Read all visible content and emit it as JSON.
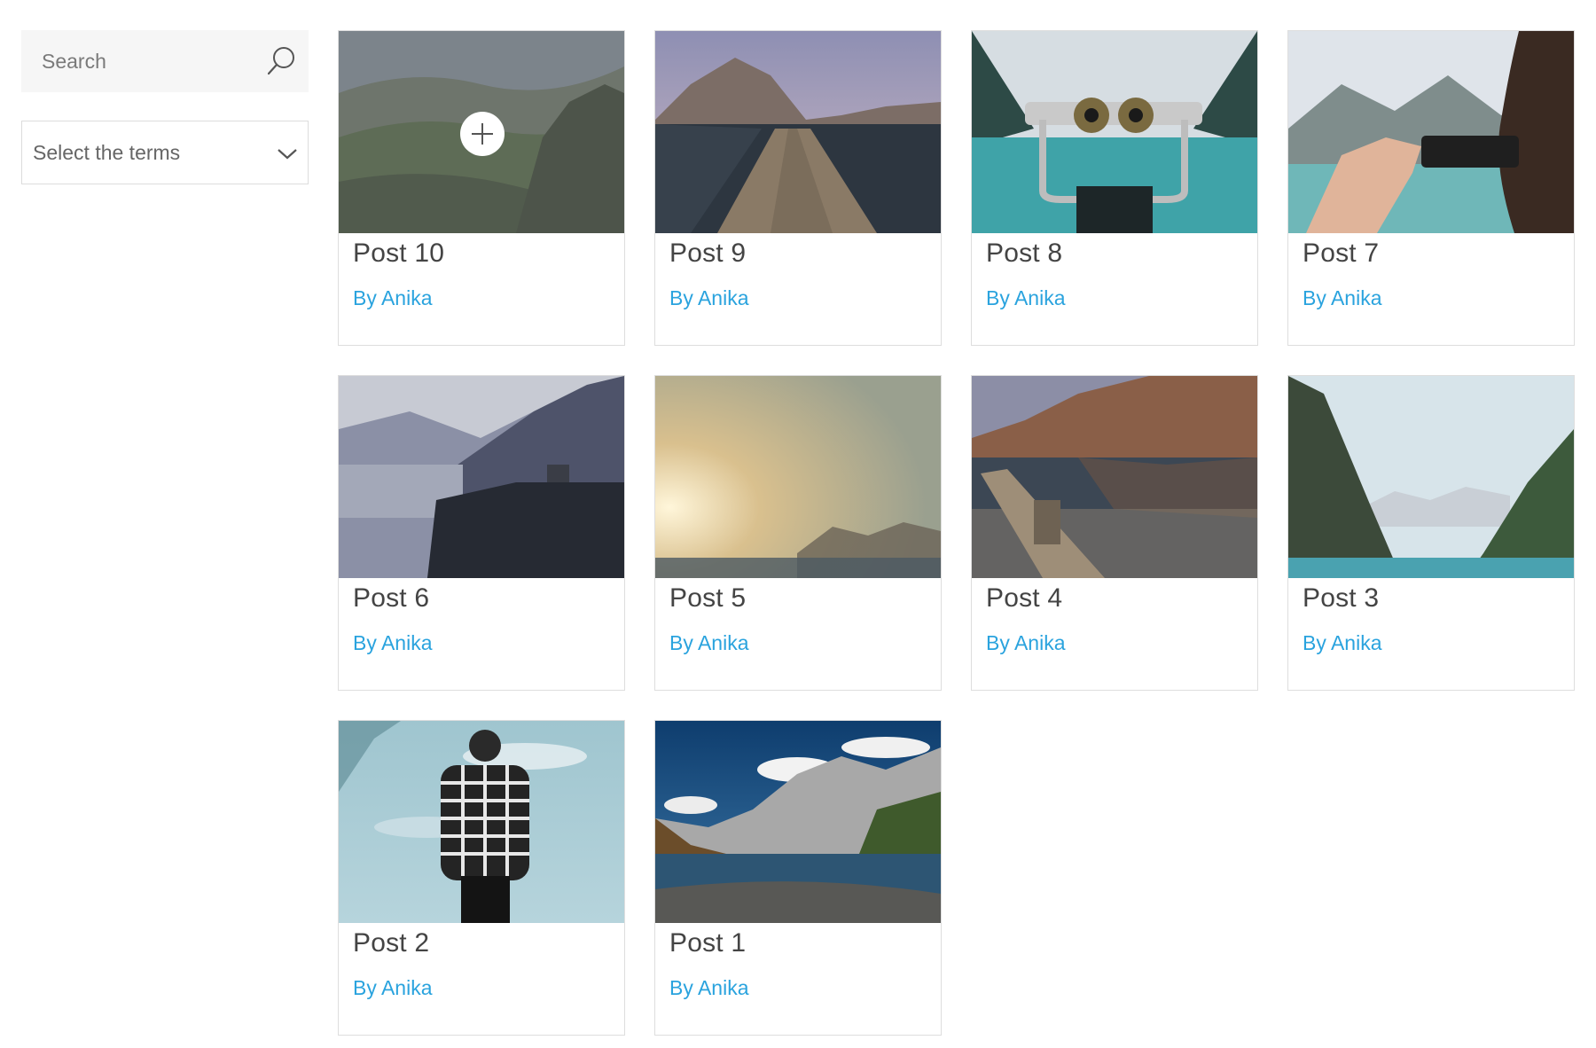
{
  "sidebar": {
    "search": {
      "placeholder": "Search",
      "icon": "search-icon"
    },
    "terms_select": {
      "selected": "Select the terms",
      "icon": "chevron-down-icon"
    }
  },
  "posts": [
    {
      "title": "Post 10",
      "author": "By Anika",
      "image": "hazy-valley-hillside",
      "hovered": true
    },
    {
      "title": "Post 9",
      "author": "By Anika",
      "image": "wooden-pier-mountain-lake"
    },
    {
      "title": "Post 8",
      "author": "By Anika",
      "image": "coin-binoculars-turquoise-lake"
    },
    {
      "title": "Post 7",
      "author": "By Anika",
      "image": "person-photographing-with-phone"
    },
    {
      "title": "Post 6",
      "author": "By Anika",
      "image": "river-gorge-cliff-vista"
    },
    {
      "title": "Post 5",
      "author": "By Anika",
      "image": "foggy-sunrise-sea"
    },
    {
      "title": "Post 4",
      "author": "By Anika",
      "image": "pier-mountain-reflection"
    },
    {
      "title": "Post 3",
      "author": "By Anika",
      "image": "glacier-valley-lake"
    },
    {
      "title": "Post 2",
      "author": "By Anika",
      "image": "man-plaid-shirt-lake"
    },
    {
      "title": "Post 1",
      "author": "By Anika",
      "image": "alpine-lake-peaks"
    }
  ],
  "colors": {
    "author_link": "#2aa3de",
    "title_text": "#444444",
    "card_border": "#dedede",
    "search_bg": "#f6f6f6"
  }
}
